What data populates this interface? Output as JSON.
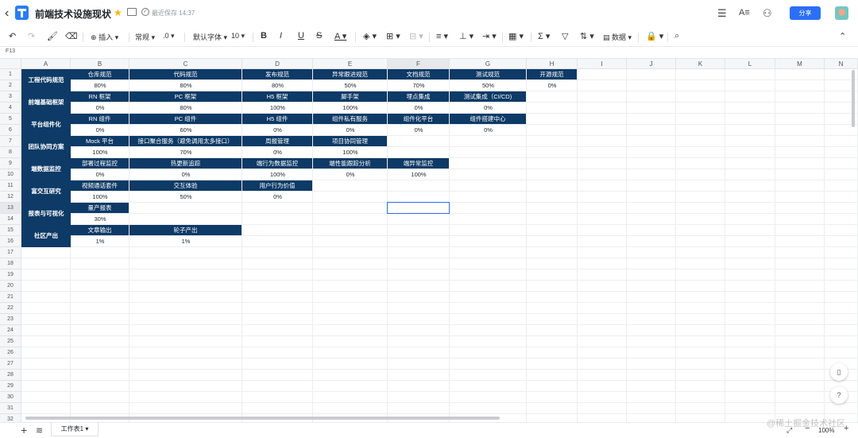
{
  "title_bar": {
    "doc_title": "前端技术设施现状",
    "saved_status": "最近保存 14:37",
    "share_label": "分享"
  },
  "toolbar": {
    "insert": "插入",
    "format": "常规",
    "decimal": ".0",
    "font": "默认字体",
    "font_size": "10",
    "sum": "Σ",
    "data": "数据"
  },
  "cell_ref": "F13",
  "columns": [
    "A",
    "B",
    "C",
    "D",
    "E",
    "F",
    "G",
    "H",
    "I",
    "J",
    "K",
    "L",
    "M",
    "N"
  ],
  "rows": [
    "1",
    "2",
    "3",
    "4",
    "5",
    "6",
    "7",
    "8",
    "9",
    "10",
    "11",
    "12",
    "13",
    "14",
    "15",
    "16",
    "17",
    "18",
    "19",
    "20",
    "21",
    "22",
    "23",
    "24",
    "25",
    "26",
    "27",
    "28",
    "29",
    "30",
    "31",
    "32"
  ],
  "groups": [
    {
      "category": "工程代码规范",
      "cells": [
        {
          "col": "B",
          "name": "仓库规范",
          "value": "80%"
        },
        {
          "col": "C",
          "name": "代码规范",
          "value": "80%"
        },
        {
          "col": "D",
          "name": "发布规范",
          "value": "80%"
        },
        {
          "col": "E",
          "name": "异常跟进规范",
          "value": "50%"
        },
        {
          "col": "F",
          "name": "文档规范",
          "value": "70%"
        },
        {
          "col": "G",
          "name": "测试规范",
          "value": "50%"
        },
        {
          "col": "H",
          "name": "开源规范",
          "value": "0%"
        }
      ]
    },
    {
      "category": "前端基础框架",
      "cells": [
        {
          "col": "B",
          "name": "RN 框架",
          "value": "0%"
        },
        {
          "col": "C",
          "name": "PC 框架",
          "value": "80%"
        },
        {
          "col": "D",
          "name": "H5 框架",
          "value": "100%"
        },
        {
          "col": "E",
          "name": "脚手架",
          "value": "100%"
        },
        {
          "col": "F",
          "name": "埋点集成",
          "value": "0%"
        },
        {
          "col": "G",
          "name": "测试集成（CI/CD)",
          "value": "0%"
        }
      ]
    },
    {
      "category": "平台组件化",
      "cells": [
        {
          "col": "B",
          "name": "RN 组件",
          "value": "0%"
        },
        {
          "col": "C",
          "name": "PC 组件",
          "value": "60%"
        },
        {
          "col": "D",
          "name": "H5 组件",
          "value": "0%"
        },
        {
          "col": "E",
          "name": "组件私有服务",
          "value": "0%"
        },
        {
          "col": "F",
          "name": "组件化平台",
          "value": "0%"
        },
        {
          "col": "G",
          "name": "组件搭建中心",
          "value": "0%"
        }
      ]
    },
    {
      "category": "团队协同方案",
      "cells": [
        {
          "col": "B",
          "name": "Mock 平台",
          "value": "100%"
        },
        {
          "col": "C",
          "name": "接口聚合服务（避免调用太多接口）",
          "value": "70%"
        },
        {
          "col": "D",
          "name": "周报管理",
          "value": "0%"
        },
        {
          "col": "E",
          "name": "项目协同管理",
          "value": "100%"
        }
      ]
    },
    {
      "category": "端数据监控",
      "cells": [
        {
          "col": "B",
          "name": "部署过程监控",
          "value": "0%"
        },
        {
          "col": "C",
          "name": "热更新追踪",
          "value": "0%"
        },
        {
          "col": "D",
          "name": "端行为数据监控",
          "value": "100%"
        },
        {
          "col": "E",
          "name": "端性能跟踪分析",
          "value": "0%"
        },
        {
          "col": "F",
          "name": "端异常监控",
          "value": "100%"
        }
      ]
    },
    {
      "category": "富交互研究",
      "cells": [
        {
          "col": "B",
          "name": "视频通话套件",
          "value": "100%"
        },
        {
          "col": "C",
          "name": "交互体验",
          "value": "50%"
        },
        {
          "col": "D",
          "name": "用户行为价值",
          "value": "0%"
        }
      ]
    },
    {
      "category": "报表与可视化",
      "cells": [
        {
          "col": "B",
          "name": "量产报表",
          "value": "30%"
        }
      ]
    },
    {
      "category": "社区产出",
      "cells": [
        {
          "col": "B",
          "name": "文章输出",
          "value": "1%"
        },
        {
          "col": "C",
          "name": "轮子产出",
          "value": "1%"
        }
      ]
    }
  ],
  "bottom": {
    "sheet_tab": "工作表1",
    "zoom": "100%",
    "watermark": "@稀土掘金技术社区"
  },
  "colors": {
    "header_fill": "#0d3a66",
    "accent": "#2a6ff6"
  }
}
